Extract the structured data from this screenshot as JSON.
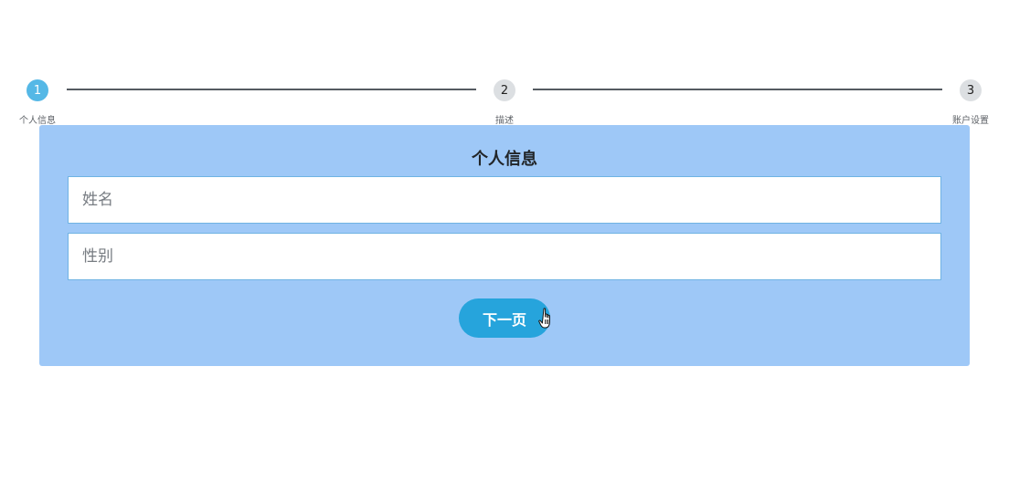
{
  "steps": [
    {
      "number": "1",
      "label": "个人信息",
      "state": "active"
    },
    {
      "number": "2",
      "label": "描述",
      "state": "inactive"
    },
    {
      "number": "3",
      "label": "账户设置",
      "state": "inactive"
    }
  ],
  "form": {
    "title": "个人信息",
    "name_placeholder": "姓名",
    "gender_placeholder": "性别",
    "next_label": "下一页"
  },
  "colors": {
    "active_step": "#55b8e6",
    "inactive_step": "#dcdfe2",
    "panel_bg": "#9ec8f7",
    "button_bg": "#26a4dc"
  },
  "icons": {
    "cursor": "hand-pointer-cursor-icon"
  }
}
